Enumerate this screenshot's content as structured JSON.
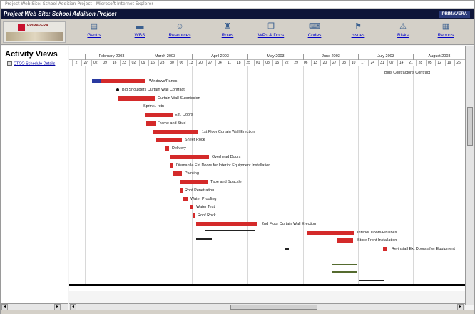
{
  "window": {
    "topstrip_text": "Project Web Site: School Addition Project - Microsoft Internet Explorer",
    "title": "Project Web Site: School Addition Project",
    "title_right": "PRIMAVERA"
  },
  "logo": {
    "text": "PRIMAVERA"
  },
  "nav": [
    {
      "label": "Gantts",
      "icon": "chart-icon"
    },
    {
      "label": "WBS",
      "icon": "wbs-icon"
    },
    {
      "label": "Resources",
      "icon": "people-icon"
    },
    {
      "label": "Roles",
      "icon": "roles-icon"
    },
    {
      "label": "WPs & Docs",
      "icon": "docs-icon"
    },
    {
      "label": "Codes",
      "icon": "codes-icon"
    },
    {
      "label": "Issues",
      "icon": "issues-icon"
    },
    {
      "label": "Risks",
      "icon": "risks-icon"
    },
    {
      "label": "Reports",
      "icon": "reports-icon"
    }
  ],
  "left_panel": {
    "heading": "Activity Views",
    "tree_item": "CTCO Schedule Details"
  },
  "timeline": {
    "months": [
      "February 2003",
      "March 2003",
      "April 2003",
      "May 2003",
      "June 2003",
      "July 2003",
      "August 2003"
    ],
    "days": [
      "2",
      "27",
      "02",
      "09",
      "16",
      "23",
      "02",
      "09",
      "16",
      "23",
      "30",
      "06",
      "13",
      "20",
      "27",
      "04",
      "11",
      "18",
      "25",
      "01",
      "08",
      "15",
      "22",
      "29",
      "06",
      "13",
      "20",
      "27",
      "03",
      "10",
      "17",
      "24",
      "31",
      "07",
      "14",
      "21",
      "28",
      "05",
      "12",
      "19",
      "26"
    ]
  },
  "activities": [
    {
      "label": "Bids Contractor's Contract"
    },
    {
      "label": "Windows/Panes"
    },
    {
      "label": "Big Shoulders Curtain Wall Contract"
    },
    {
      "label": "Curtain Wall Submission"
    },
    {
      "label": "Sprinkl. rstn"
    },
    {
      "label": "Ext. Doors"
    },
    {
      "label": "Frame and Stud"
    },
    {
      "label": "1st Floor Curtain Wall Erection"
    },
    {
      "label": "Sheet Rock"
    },
    {
      "label": "Delivery"
    },
    {
      "label": "Overhead Doors"
    },
    {
      "label": "Dismantle Ext Doors for Interior Equipment Installation"
    },
    {
      "label": "Painting"
    },
    {
      "label": "Tape and Spackle"
    },
    {
      "label": "Roof Penetration"
    },
    {
      "label": "Water Proofing"
    },
    {
      "label": "Water Test"
    },
    {
      "label": "Roof Rock"
    },
    {
      "label": "2nd Floor Curtain Wall Erection"
    },
    {
      "label": "Interior Doors/Finishes"
    },
    {
      "label": "Store Front Installation"
    },
    {
      "label": "Re-install Ext Doors after Equipment"
    }
  ],
  "colors": {
    "bar": "#d42a2a",
    "title_bg": "#0e1538"
  }
}
